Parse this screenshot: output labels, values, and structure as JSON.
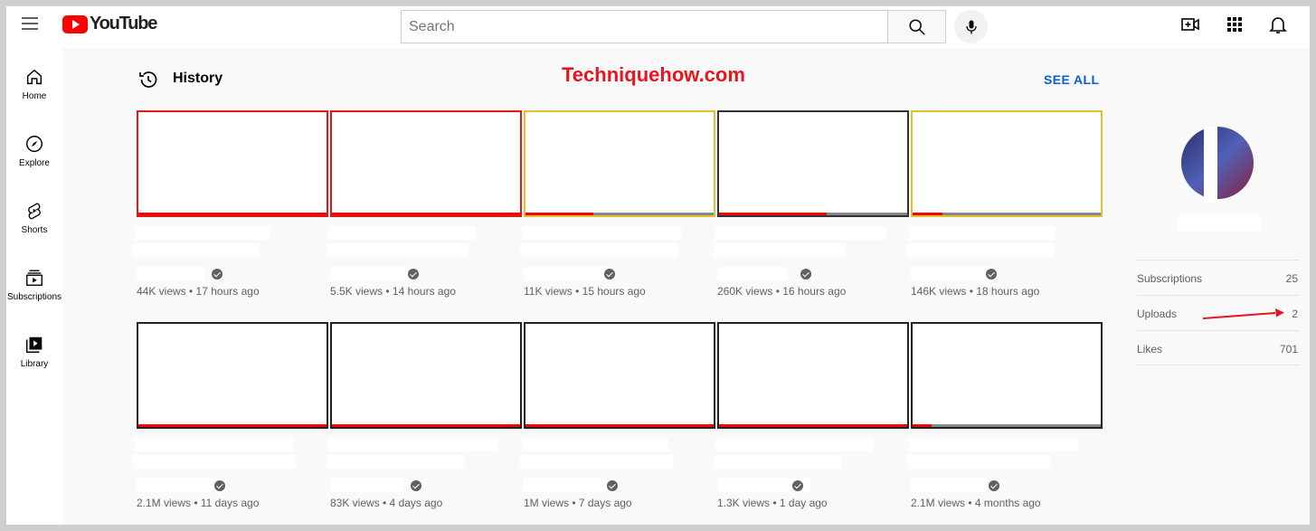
{
  "header": {
    "logo_text": "YouTube",
    "search_placeholder": "Search"
  },
  "sidebar": {
    "items": [
      {
        "label": "Home",
        "icon": "home-icon"
      },
      {
        "label": "Explore",
        "icon": "compass-icon"
      },
      {
        "label": "Shorts",
        "icon": "shorts-icon"
      },
      {
        "label": "Subscriptions",
        "icon": "subscriptions-icon"
      },
      {
        "label": "Library",
        "icon": "library-icon"
      }
    ]
  },
  "main": {
    "section_title": "History",
    "watermark": "Techniquehow.com",
    "see_all": "SEE ALL",
    "videos": [
      {
        "meta": "44K views • 17 hours ago",
        "progress": 1.0
      },
      {
        "meta": "5.5K views • 14 hours ago",
        "progress": 1.0
      },
      {
        "meta": "11K views • 15 hours ago",
        "progress": 0.36
      },
      {
        "meta": "260K views • 16 hours ago",
        "progress": 0.57
      },
      {
        "meta": "146K views • 18 hours ago",
        "progress": 0.16
      },
      {
        "meta": "2.1M views • 11 days ago",
        "progress": 1.0
      },
      {
        "meta": "83K views • 4 days ago",
        "progress": 1.0
      },
      {
        "meta": "1M views • 7 days ago",
        "progress": 1.0
      },
      {
        "meta": "1.3K views • 1 day ago",
        "progress": 1.0
      },
      {
        "meta": "2.1M views • 4 months ago",
        "progress": 0.1
      }
    ]
  },
  "channel": {
    "stats": [
      {
        "label": "Subscriptions",
        "value": "25"
      },
      {
        "label": "Uploads",
        "value": "2"
      },
      {
        "label": "Likes",
        "value": "701"
      }
    ]
  },
  "colors": {
    "brand_red": "#ff0000",
    "watermark_red": "#e8141e",
    "link_blue": "#065fd4"
  }
}
